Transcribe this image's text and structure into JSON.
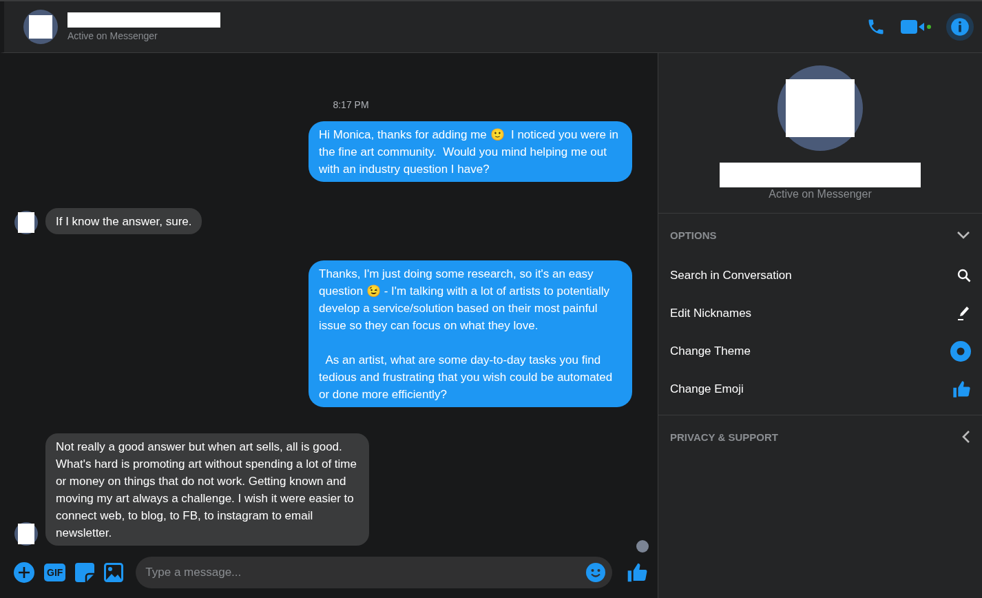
{
  "header": {
    "status": "Active on Messenger",
    "online": true,
    "actions": [
      {
        "kind": "call",
        "selected": false
      },
      {
        "kind": "video",
        "selected": false
      },
      {
        "kind": "info",
        "selected": true
      }
    ]
  },
  "chat": {
    "time": "8:17 PM",
    "messages": [
      {
        "kind": "sent",
        "text": "Hi Monica, thanks for adding me 🙂  I noticed you were in the fine art community.  Would you mind helping me out with an industry question I have?"
      },
      {
        "kind": "received",
        "text": "If I know the answer, sure."
      },
      {
        "kind": "sent",
        "text": "Thanks, I'm just doing some research, so it's an easy question 😉 - I'm talking with a lot of artists to potentially develop a service/solution based on their most painful issue so they can focus on what they love.\n\n  As an artist, what are some day-to-day tasks you find tedious and frustrating that you wish could be automated or done more efficiently?"
      },
      {
        "kind": "received",
        "text": "Not really a good answer but when art sells, all is good. What's hard is promoting art without spending a lot of time or money on things that do not work. Getting known and moving my art always a challenge. I wish it were easier to connect web, to blog, to FB, to instagram to email newsletter."
      }
    ]
  },
  "composer": {
    "placeholder": "Type a message...",
    "gif_label": "GIF"
  },
  "panel": {
    "status": "Active on Messenger",
    "sections": [
      {
        "title": "OPTIONS",
        "expanded": true,
        "items": [
          {
            "label": "Search in Conversation",
            "kind": "search"
          },
          {
            "label": "Edit Nicknames",
            "kind": "pen"
          },
          {
            "label": "Change Theme",
            "kind": "theme"
          },
          {
            "label": "Change Emoji",
            "kind": "emoji"
          }
        ]
      },
      {
        "title": "PRIVACY & SUPPORT",
        "expanded": false
      }
    ]
  }
}
